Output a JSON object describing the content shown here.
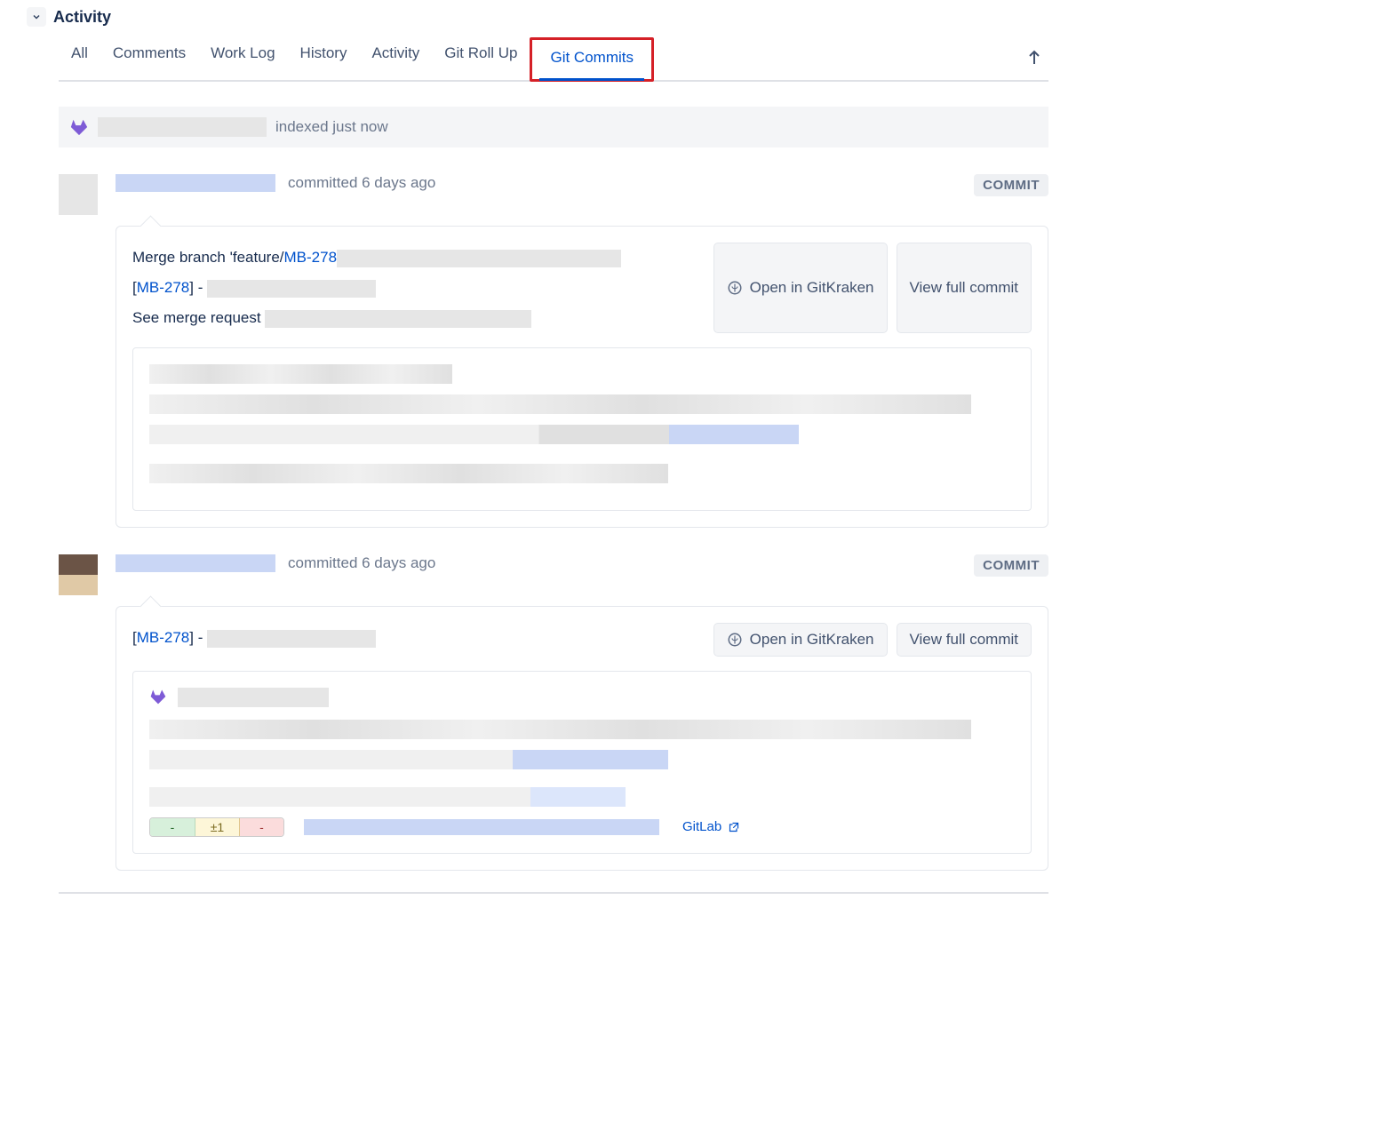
{
  "section": {
    "title": "Activity"
  },
  "tabs": {
    "all": "All",
    "comments": "Comments",
    "worklog": "Work Log",
    "history": "History",
    "activity": "Activity",
    "gitrollup": "Git Roll Up",
    "gitcommits": "Git Commits"
  },
  "index_bar": {
    "text": "indexed just now"
  },
  "commit1": {
    "meta": "committed 6 days ago",
    "badge": "COMMIT",
    "line1_prefix": "Merge branch 'feature/",
    "line1_link": "MB-278",
    "bracket_open": "[",
    "bracket_link": "MB-278",
    "bracket_close": "] - ",
    "see_merge": "See merge request ",
    "btn_open": "Open in GitKraken",
    "btn_view": "View full commit"
  },
  "commit2": {
    "meta": "committed 6 days ago",
    "badge": "COMMIT",
    "bracket_open": "[",
    "bracket_link": "MB-278",
    "bracket_close": "] - ",
    "btn_open": "Open in GitKraken",
    "btn_view": "View full commit",
    "diff_add": "-",
    "diff_mod": "±1",
    "diff_del": "-",
    "gitlab_label": "GitLab"
  }
}
